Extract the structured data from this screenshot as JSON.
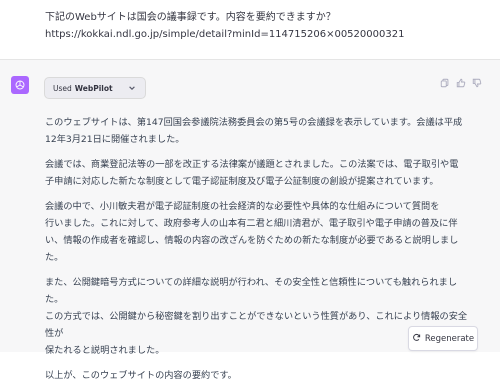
{
  "user_message": {
    "lines": [
      "下記のWebサイトは国会の議事録です。内容を要約できますか？",
      "https://kokkai.ndl.go.jp/simple/detail?minId=114715206×00520000321"
    ]
  },
  "assistant": {
    "avatar_icon": "openai-logo-icon",
    "avatar_color": "#ab68ff",
    "plugin_used": {
      "prefix": "Used",
      "name": "WebPilot"
    },
    "paragraphs": [
      [
        "このウェブサイトは、第147回国会参議院法務委員会の第5号の会議録を表示しています。会議は平成",
        "12年3月21日に開催されました。"
      ],
      [
        "会議では、商業登記法等の一部を改正する法律案が議題とされました。この法案では、電子取引や電",
        "子申請に対応した新たな制度として電子認証制度及び電子公証制度の創設が提案されています。"
      ],
      [
        "会議の中で、小川敏夫君が電子認証制度の社会経済的な必要性や具体的な仕組みについて質問を",
        "行いました。これに対して、政府参考人の山本有二君と細川清君が、電子取引や電子申請の普及に伴",
        "い、情報の作成者を確認し、情報の内容の改ざんを防ぐための新たな制度が必要であると説明しました。"
      ],
      [
        "また、公開鍵暗号方式についての詳細な説明が行われ、その安全性と信頼性についても触れられました。",
        "この方式では、公開鍵から秘密鍵を割り出すことができないという性質があり、これにより情報の安全性が",
        "保たれると説明されました。"
      ],
      [
        "以上が、このウェブサイトの内容の要約です。"
      ]
    ]
  },
  "actions": [
    "copy-icon",
    "thumbs-up-icon",
    "thumbs-down-icon"
  ],
  "regenerate_label": "Regenerate"
}
